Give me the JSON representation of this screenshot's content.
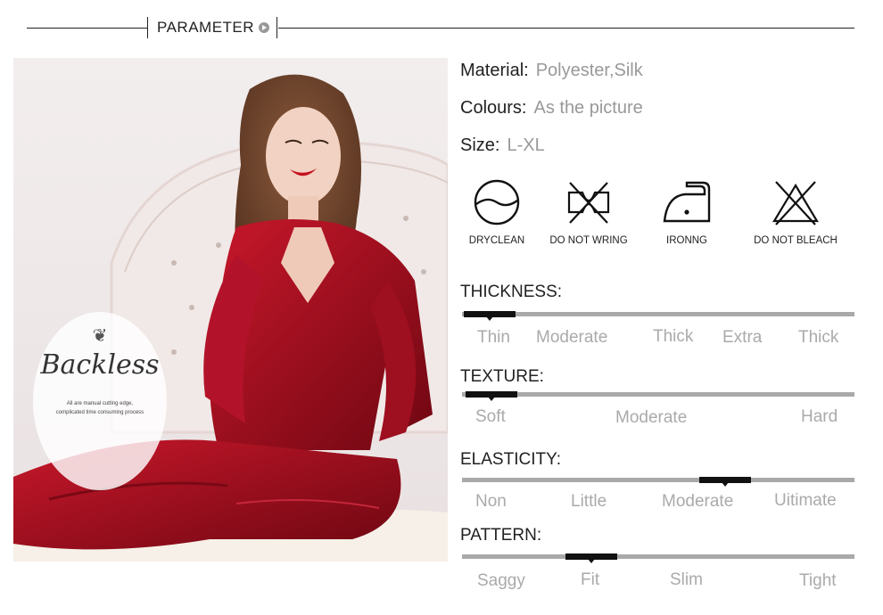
{
  "header": {
    "title": "PARAMETER"
  },
  "badge": {
    "title": "Backless",
    "line1": "All are manual cutting edge,",
    "line2": "complicated time consuming process"
  },
  "attributes": {
    "material": {
      "label": "Material:",
      "value": "Polyester,Silk"
    },
    "colours": {
      "label": "Colours:",
      "value": "As the picture"
    },
    "size": {
      "label": "Size:",
      "value": "L-XL"
    }
  },
  "care": [
    {
      "icon": "dryclean-icon",
      "label": "DRYCLEAN"
    },
    {
      "icon": "do-not-wring-icon",
      "label": "DO NOT WRING"
    },
    {
      "icon": "ironing-icon",
      "label": "IRONNG"
    },
    {
      "icon": "do-not-bleach-icon",
      "label": "DO NOT BLEACH"
    }
  ],
  "scales": {
    "thickness": {
      "title": "THICKNESS:",
      "options": [
        "Thin",
        "Moderate",
        "Thick",
        "Extra",
        "Thick"
      ],
      "selected": "Thin"
    },
    "texture": {
      "title": "TEXTURE:",
      "options": [
        "Soft",
        "Moderate",
        "Hard"
      ],
      "selected": "Soft"
    },
    "elasticity": {
      "title": "ELASTICITY:",
      "options": [
        "Non",
        "Little",
        "Moderate",
        "Uitimate"
      ],
      "selected": "Moderate"
    },
    "pattern": {
      "title": "PATTERN:",
      "options": [
        "Saggy",
        "Fit",
        "Slim",
        "Tight"
      ],
      "selected": "Fit"
    }
  },
  "colors": {
    "garment": "#a3101f",
    "scale_bar": "#a9a9a9",
    "marker": "#111111",
    "muted_text": "#999999"
  }
}
